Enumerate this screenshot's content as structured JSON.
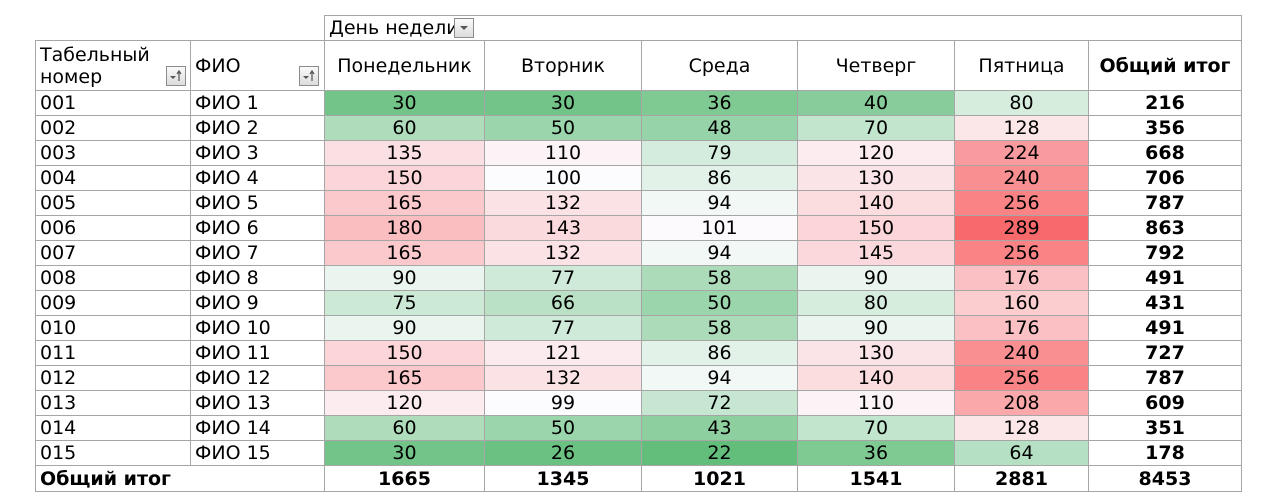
{
  "pivot": {
    "column_field_label": "День недели",
    "row_header_1": "Табельный номер",
    "row_header_1_line1": "Табельный",
    "row_header_1_line2": "номер",
    "row_header_2": "ФИО",
    "days": [
      "Понедельник",
      "Вторник",
      "Среда",
      "Четверг",
      "Пятница"
    ],
    "grand_total_label": "Общий итог",
    "rows": [
      {
        "id": "001",
        "name": "ФИО 1",
        "values": [
          30,
          30,
          36,
          40,
          80
        ],
        "total": 216
      },
      {
        "id": "002",
        "name": "ФИО 2",
        "values": [
          60,
          50,
          48,
          70,
          128
        ],
        "total": 356
      },
      {
        "id": "003",
        "name": "ФИО 3",
        "values": [
          135,
          110,
          79,
          120,
          224
        ],
        "total": 668
      },
      {
        "id": "004",
        "name": "ФИО 4",
        "values": [
          150,
          100,
          86,
          130,
          240
        ],
        "total": 706
      },
      {
        "id": "005",
        "name": "ФИО 5",
        "values": [
          165,
          132,
          94,
          140,
          256
        ],
        "total": 787
      },
      {
        "id": "006",
        "name": "ФИО 6",
        "values": [
          180,
          143,
          101,
          150,
          289
        ],
        "total": 863
      },
      {
        "id": "007",
        "name": "ФИО 7",
        "values": [
          165,
          132,
          94,
          145,
          256
        ],
        "total": 792
      },
      {
        "id": "008",
        "name": "ФИО 8",
        "values": [
          90,
          77,
          58,
          90,
          176
        ],
        "total": 491
      },
      {
        "id": "009",
        "name": "ФИО 9",
        "values": [
          75,
          66,
          50,
          80,
          160
        ],
        "total": 431
      },
      {
        "id": "010",
        "name": "ФИО 10",
        "values": [
          90,
          77,
          58,
          90,
          176
        ],
        "total": 491
      },
      {
        "id": "011",
        "name": "ФИО 11",
        "values": [
          150,
          121,
          86,
          130,
          240
        ],
        "total": 727
      },
      {
        "id": "012",
        "name": "ФИО 12",
        "values": [
          165,
          132,
          94,
          140,
          256
        ],
        "total": 787
      },
      {
        "id": "013",
        "name": "ФИО 13",
        "values": [
          120,
          99,
          72,
          110,
          208
        ],
        "total": 609
      },
      {
        "id": "014",
        "name": "ФИО 14",
        "values": [
          60,
          50,
          43,
          70,
          128
        ],
        "total": 351
      },
      {
        "id": "015",
        "name": "ФИО 15",
        "values": [
          30,
          26,
          22,
          36,
          64
        ],
        "total": 178
      }
    ],
    "column_totals": [
      1665,
      1345,
      1021,
      1541,
      2881
    ],
    "grand_total": 8453
  },
  "colors": {
    "low": "#63be7b",
    "mid": "#fcfcff",
    "high": "#f8696b",
    "grid": "#a6a6a6"
  },
  "icons": {
    "column_filter": "dropdown-arrow-icon",
    "row_sort": "sort-filter-icon"
  }
}
